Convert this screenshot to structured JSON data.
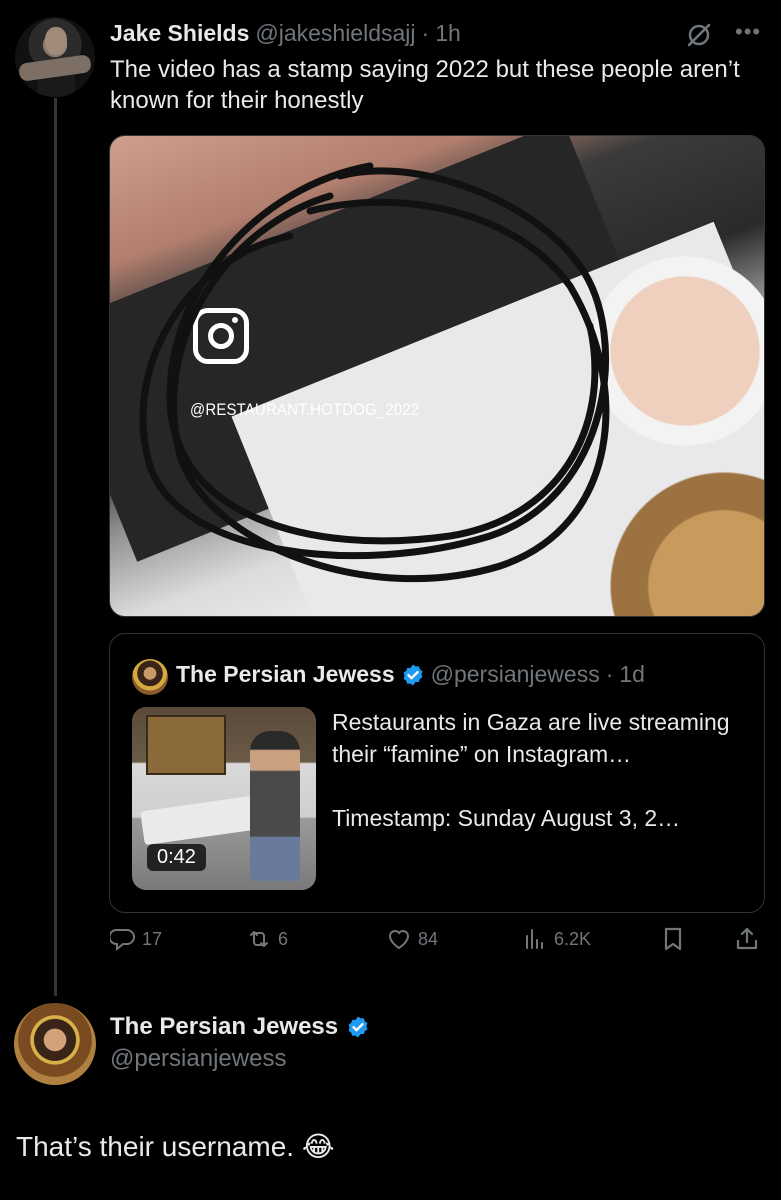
{
  "tweet": {
    "author_name": "Jake Shields",
    "author_handle": "@jakeshieldsajj",
    "separator": "·",
    "time": "1h",
    "text": "The video has a stamp saying 2022 but these people aren’t known for their honestly",
    "media": {
      "watermark_handle": "@RESTAURANT.HOTDOG_2022",
      "icon": "instagram-icon"
    },
    "quote": {
      "author_name": "The Persian Jewess",
      "author_handle": "@persianjewess",
      "separator": "·",
      "time": "1d",
      "text_line1": "Restaurants in Gaza are live streaming their “famine” on Instagram…",
      "text_line2": "Timestamp: Sunday August 3, 2…",
      "video_duration": "0:42"
    },
    "actions": {
      "replies": "17",
      "reposts": "6",
      "likes": "84",
      "views": "6.2K"
    }
  },
  "reply": {
    "author_name": "The Persian Jewess",
    "author_handle": "@persianjewess",
    "text": "That’s their username. 😂"
  },
  "colors": {
    "background": "#000000",
    "text": "#e7e9ea",
    "muted": "#71767b",
    "verified": "#1d9bf0",
    "border": "#2f3336"
  }
}
